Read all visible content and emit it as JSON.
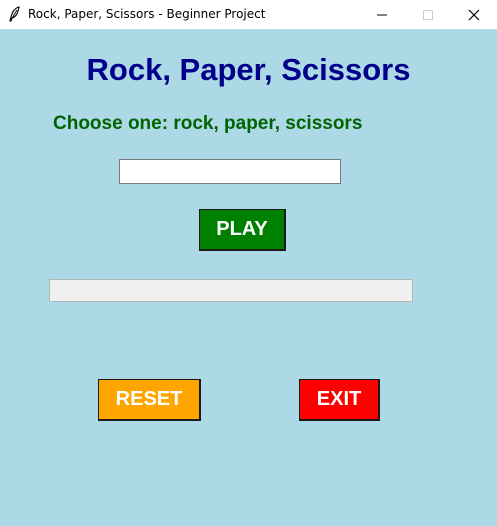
{
  "window": {
    "title": "Rock, Paper, Scissors - Beginner Project",
    "icon": "feather-icon",
    "controls": [
      "minimize-icon",
      "maximize-icon",
      "close-icon"
    ],
    "background_color": "#add8e6"
  },
  "main": {
    "heading": "Rock, Paper, Scissors",
    "instructions": "Choose one: rock, paper, scissors",
    "choice_input": {
      "value": "",
      "placeholder": ""
    },
    "play_label": "PLAY",
    "result_text": "",
    "reset_label": "RESET",
    "exit_label": "EXIT"
  },
  "colors": {
    "heading": "#00008b",
    "instructions": "#006400",
    "play": "#008000",
    "reset": "#ffa500",
    "exit": "#ff0000",
    "result_background": "#f0f0f0"
  }
}
